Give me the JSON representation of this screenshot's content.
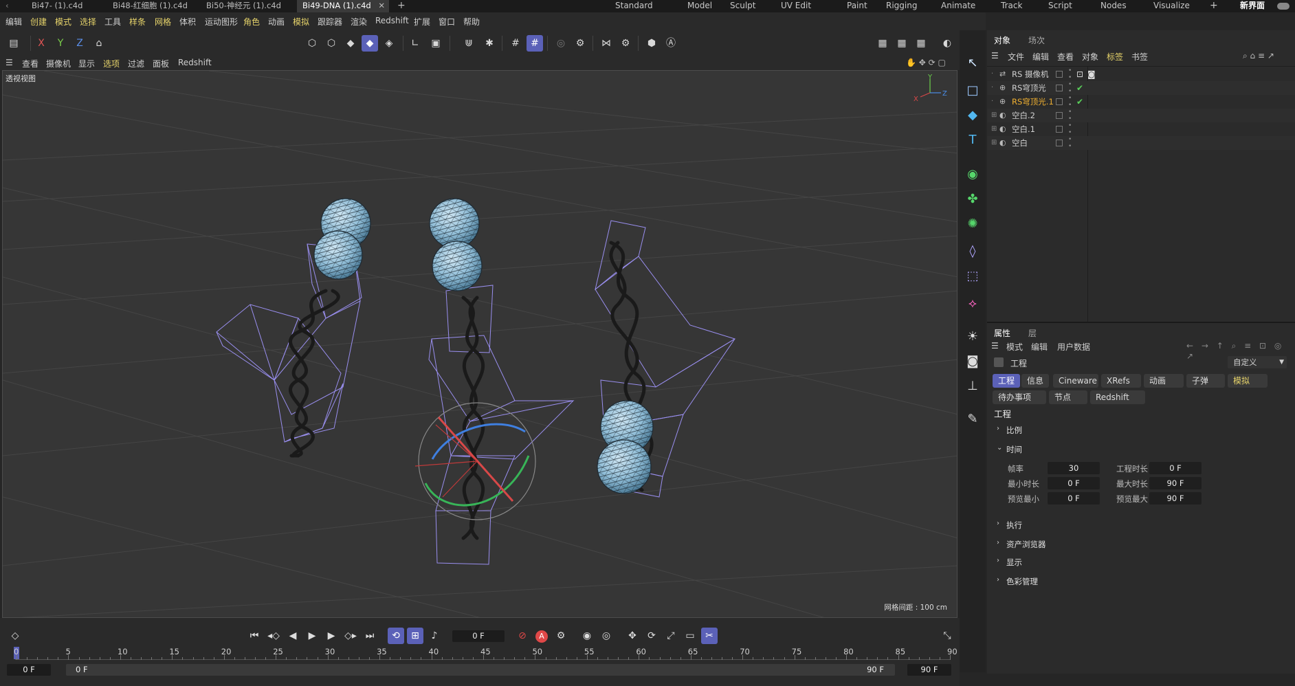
{
  "doc_tabs": [
    {
      "label": "Bi47- (1).c4d"
    },
    {
      "label": "Bi48-红细胞 (1).c4d"
    },
    {
      "label": "Bi50-神经元 (1).c4d"
    },
    {
      "label": "Bi49-DNA (1).c4d",
      "active": true
    }
  ],
  "layout_tabs": [
    "Standard",
    "Model",
    "Sculpt",
    "UV Edit",
    "Paint",
    "Rigging",
    "Animate",
    "Track",
    "Script",
    "Nodes",
    "Visualize"
  ],
  "new_interface": "新界面",
  "menu": [
    "编辑",
    "创建",
    "模式",
    "选择",
    "工具",
    "样条",
    "网格",
    "体积",
    "运动图形",
    "角色",
    "动画",
    "模拟",
    "跟踪器",
    "渲染",
    "Redshift",
    "扩展",
    "窗口",
    "帮助"
  ],
  "menu_highlight": [
    "创建",
    "模式",
    "选择",
    "样条",
    "网格",
    "角色",
    "模拟"
  ],
  "axis_buttons": [
    "X",
    "Y",
    "Z"
  ],
  "viewport_menu": [
    "查看",
    "摄像机",
    "显示",
    "选项",
    "过滤",
    "面板",
    "Redshift"
  ],
  "viewport": {
    "label": "透视视图",
    "grid_spacing": "网格间距 : 100 cm",
    "axis_labels": {
      "y": "Y",
      "x": "X",
      "z": "Z"
    }
  },
  "object_manager": {
    "tabs": [
      "对象",
      "场次"
    ],
    "menu": [
      "文件",
      "编辑",
      "查看",
      "对象",
      "标签",
      "书签"
    ],
    "objects": [
      {
        "name": "RS 摄像机",
        "color": "#d0d0d0",
        "tags": [
          "target",
          "camera"
        ]
      },
      {
        "name": "RS穹顶光",
        "color": "#d0d0d0",
        "tags": [
          "check"
        ]
      },
      {
        "name": "RS穹顶光.1",
        "color": "#f0b030",
        "tags": [
          "check"
        ]
      },
      {
        "name": "空白.2",
        "color": "#d0d0d0",
        "tags": []
      },
      {
        "name": "空白.1",
        "color": "#d0d0d0",
        "tags": []
      },
      {
        "name": "空白",
        "color": "#d0d0d0",
        "tags": []
      }
    ]
  },
  "attributes": {
    "tabs": [
      "属性",
      "层"
    ],
    "menu": [
      "模式",
      "编辑",
      "用户数据"
    ],
    "object_label": "工程",
    "preset": "自定义",
    "chips_row1": [
      "工程",
      "信息",
      "Cineware",
      "XRefs",
      "动画",
      "子弹",
      "模拟"
    ],
    "chips_row2": [
      "待办事项",
      "节点",
      "Redshift"
    ],
    "section_title": "工程",
    "groups": [
      "比例",
      "时间",
      "执行",
      "资产浏览器",
      "显示",
      "色彩管理"
    ],
    "time_fields": [
      {
        "label": "帧率",
        "value": "30"
      },
      {
        "label": "工程时长",
        "value": "0 F"
      },
      {
        "label": "最小时长",
        "value": "0 F"
      },
      {
        "label": "最大时长",
        "value": "90 F"
      },
      {
        "label": "预览最小",
        "value": "0 F"
      },
      {
        "label": "预览最大",
        "value": "90 F"
      }
    ]
  },
  "timeline": {
    "current_frame": "0 F",
    "ruler": [
      "0",
      "5",
      "10",
      "15",
      "20",
      "25",
      "30",
      "35",
      "40",
      "45",
      "50",
      "55",
      "60",
      "65",
      "70",
      "75",
      "80",
      "85",
      "90"
    ],
    "start_field": "0 F",
    "range_start": "0 F",
    "range_end": "90 F",
    "end_field": "90 F"
  },
  "colors": {
    "accent": "#5b61b8",
    "highlight_text": "#e6d36a",
    "selected_object": "#f0b030",
    "cage": "#9a8ff0",
    "sphere": "#8fc0dd"
  }
}
